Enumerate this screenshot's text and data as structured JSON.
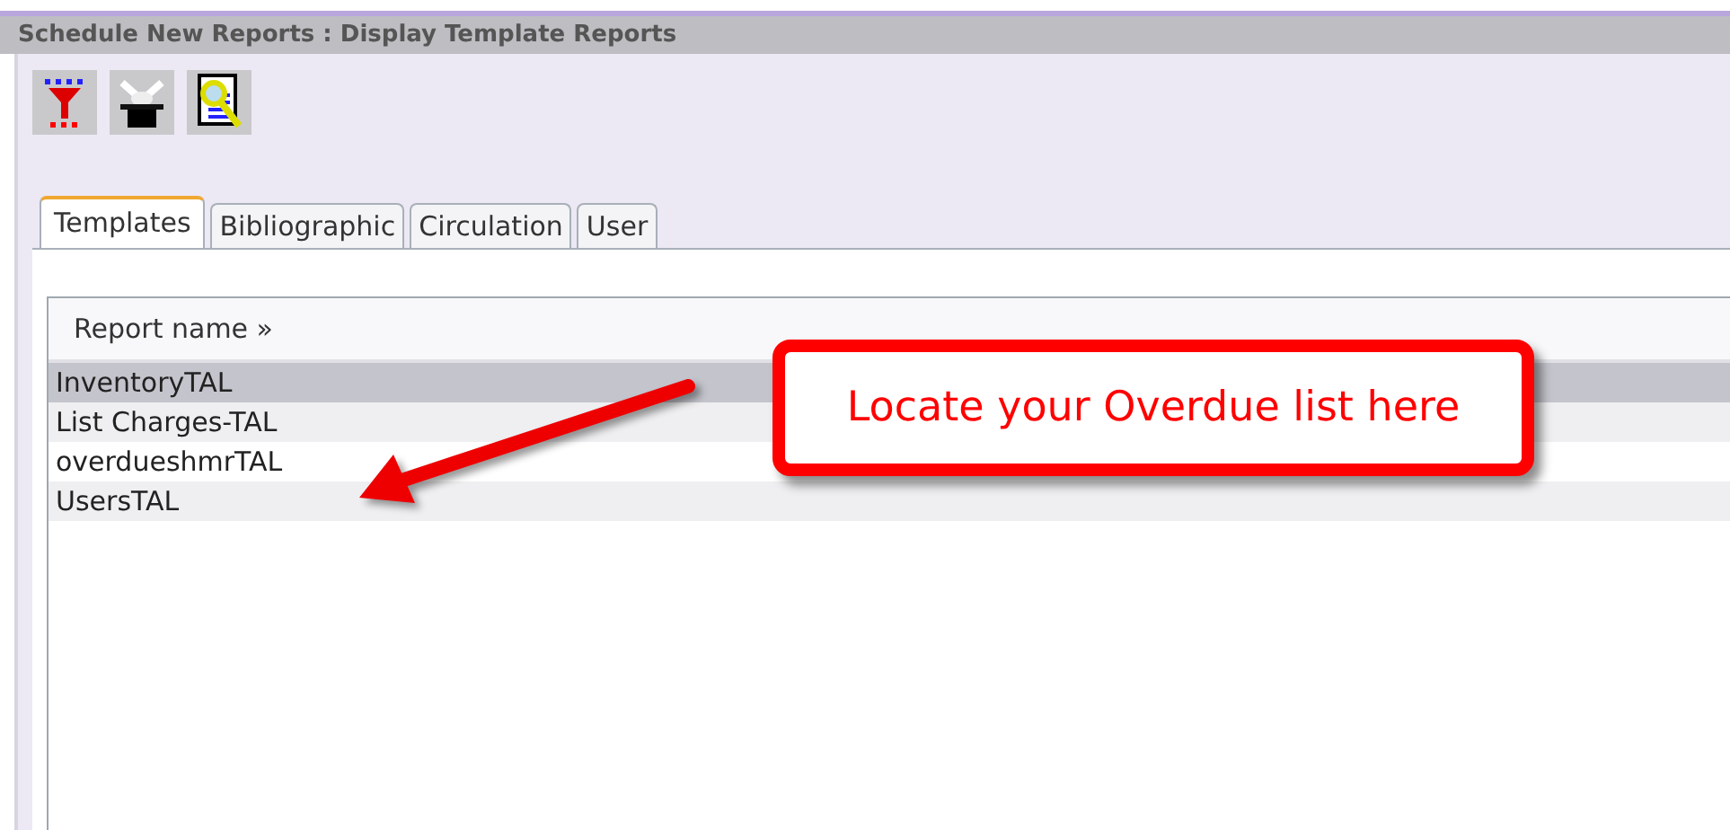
{
  "window": {
    "title": "Schedule New Reports : Display Template Reports"
  },
  "toolbar": {
    "buttons": [
      {
        "kind": "filter"
      },
      {
        "kind": "hat"
      },
      {
        "kind": "magnify"
      }
    ]
  },
  "tabs": [
    {
      "label": "Templates",
      "selected": true
    },
    {
      "label": "Bibliographic",
      "selected": false
    },
    {
      "label": "Circulation",
      "selected": false
    },
    {
      "label": "User",
      "selected": false
    }
  ],
  "table": {
    "columns": [
      "Report name »"
    ],
    "rows": [
      {
        "name": "InventoryTAL",
        "selected": true
      },
      {
        "name": "List Charges-TAL",
        "selected": false
      },
      {
        "name": "overdueshmrTAL",
        "selected": false
      },
      {
        "name": "UsersTAL",
        "selected": false
      }
    ]
  },
  "callout": {
    "text": "Locate your Overdue list here"
  }
}
